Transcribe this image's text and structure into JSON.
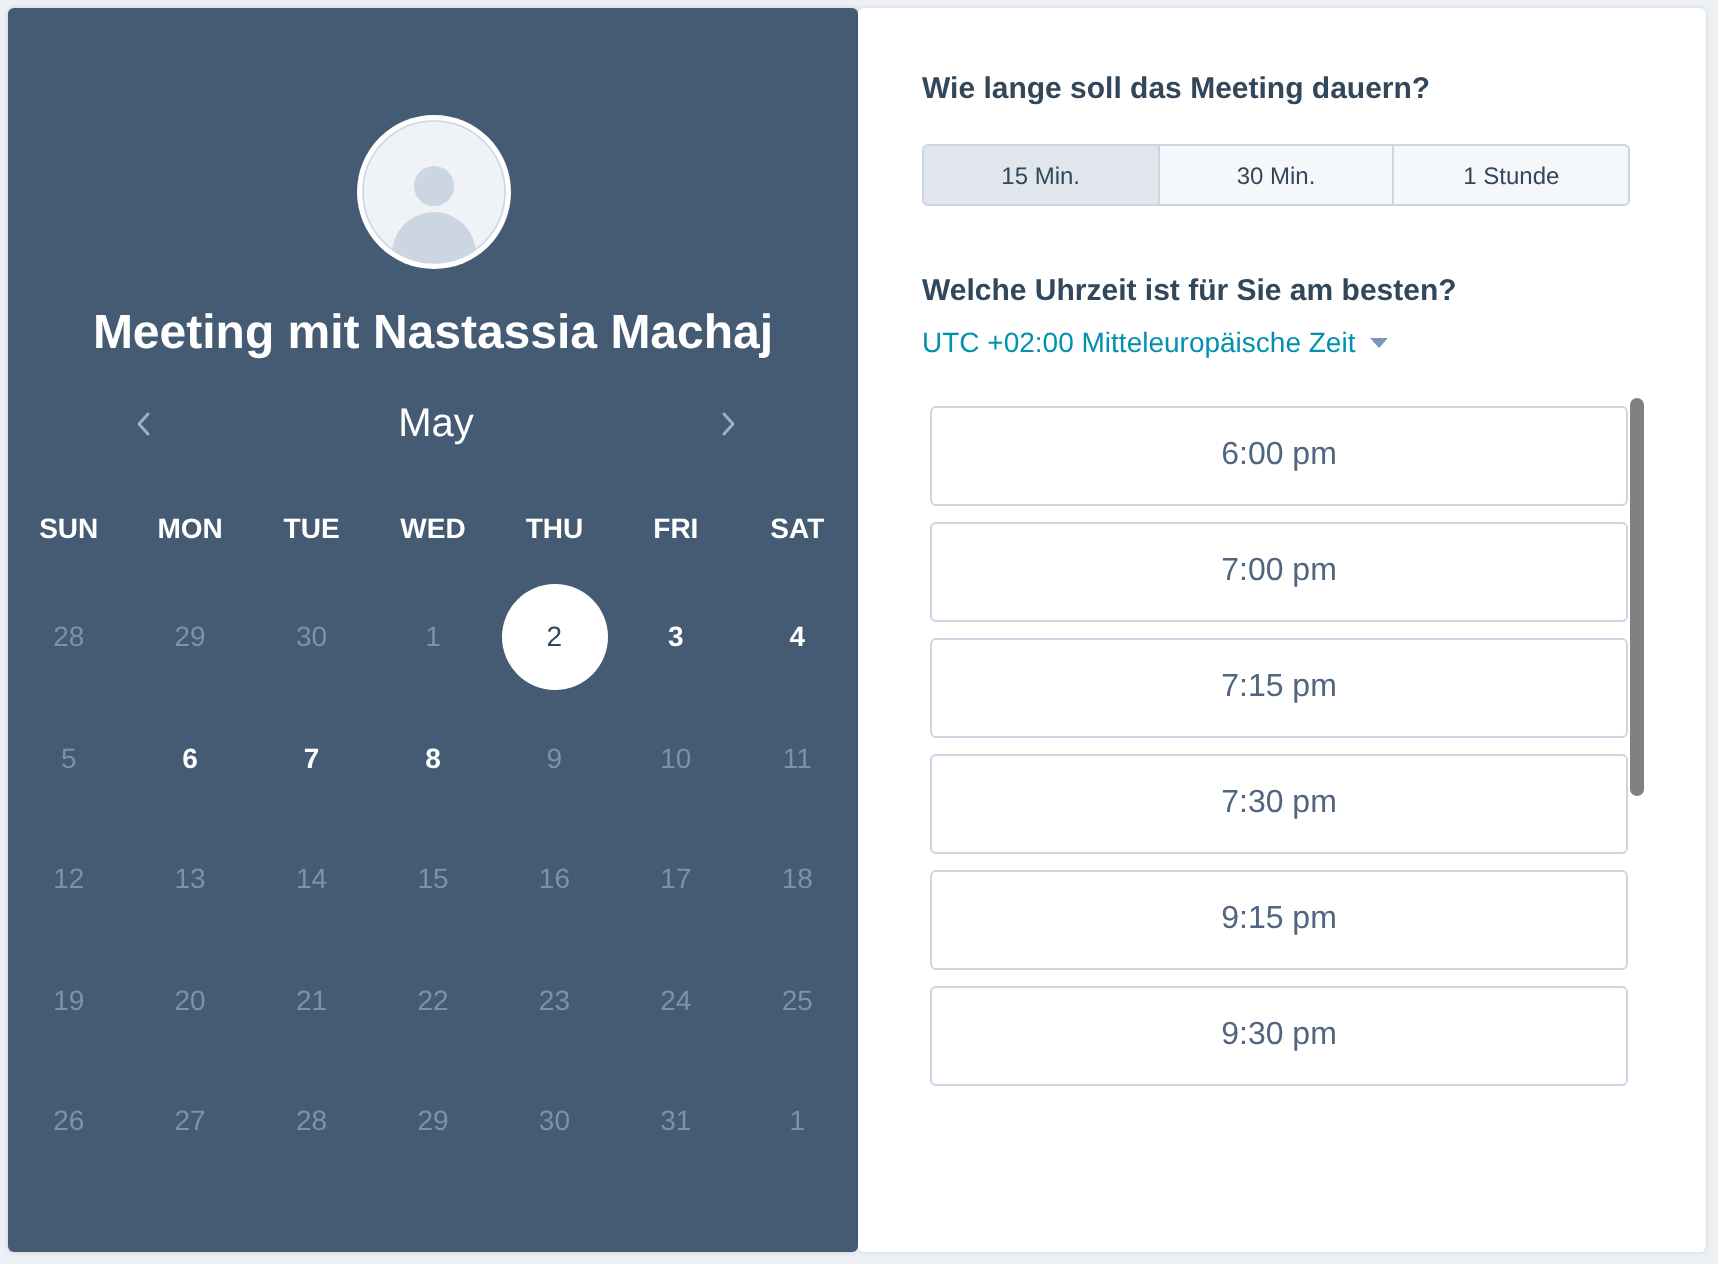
{
  "profile": {
    "title": "Meeting mit Nastassia Machaj"
  },
  "calendar": {
    "month": "May",
    "weekdays": [
      "SUN",
      "MON",
      "TUE",
      "WED",
      "THU",
      "FRI",
      "SAT"
    ],
    "weeks": [
      [
        {
          "day": "28",
          "available": false,
          "selected": false
        },
        {
          "day": "29",
          "available": false,
          "selected": false
        },
        {
          "day": "30",
          "available": false,
          "selected": false
        },
        {
          "day": "1",
          "available": false,
          "selected": false
        },
        {
          "day": "2",
          "available": true,
          "selected": true
        },
        {
          "day": "3",
          "available": true,
          "selected": false
        },
        {
          "day": "4",
          "available": true,
          "selected": false
        }
      ],
      [
        {
          "day": "5",
          "available": false,
          "selected": false
        },
        {
          "day": "6",
          "available": true,
          "selected": false
        },
        {
          "day": "7",
          "available": true,
          "selected": false
        },
        {
          "day": "8",
          "available": true,
          "selected": false
        },
        {
          "day": "9",
          "available": false,
          "selected": false
        },
        {
          "day": "10",
          "available": false,
          "selected": false
        },
        {
          "day": "11",
          "available": false,
          "selected": false
        }
      ],
      [
        {
          "day": "12",
          "available": false,
          "selected": false
        },
        {
          "day": "13",
          "available": false,
          "selected": false
        },
        {
          "day": "14",
          "available": false,
          "selected": false
        },
        {
          "day": "15",
          "available": false,
          "selected": false
        },
        {
          "day": "16",
          "available": false,
          "selected": false
        },
        {
          "day": "17",
          "available": false,
          "selected": false
        },
        {
          "day": "18",
          "available": false,
          "selected": false
        }
      ],
      [
        {
          "day": "19",
          "available": false,
          "selected": false
        },
        {
          "day": "20",
          "available": false,
          "selected": false
        },
        {
          "day": "21",
          "available": false,
          "selected": false
        },
        {
          "day": "22",
          "available": false,
          "selected": false
        },
        {
          "day": "23",
          "available": false,
          "selected": false
        },
        {
          "day": "24",
          "available": false,
          "selected": false
        },
        {
          "day": "25",
          "available": false,
          "selected": false
        }
      ],
      [
        {
          "day": "26",
          "available": false,
          "selected": false
        },
        {
          "day": "27",
          "available": false,
          "selected": false
        },
        {
          "day": "28",
          "available": false,
          "selected": false
        },
        {
          "day": "29",
          "available": false,
          "selected": false
        },
        {
          "day": "30",
          "available": false,
          "selected": false
        },
        {
          "day": "31",
          "available": false,
          "selected": false
        },
        {
          "day": "1",
          "available": false,
          "selected": false
        }
      ]
    ]
  },
  "duration": {
    "question": "Wie lange soll das Meeting dauern?",
    "options": [
      {
        "label": "15 Min.",
        "selected": true
      },
      {
        "label": "30 Min.",
        "selected": false
      },
      {
        "label": "1 Stunde",
        "selected": false
      }
    ]
  },
  "time": {
    "question": "Welche Uhrzeit ist für Sie am besten?",
    "timezone": "UTC +02:00 Mitteleuropäische Zeit",
    "slots": [
      "6:00 pm",
      "7:00 pm",
      "7:15 pm",
      "7:30 pm",
      "9:15 pm",
      "9:30 pm"
    ]
  }
}
